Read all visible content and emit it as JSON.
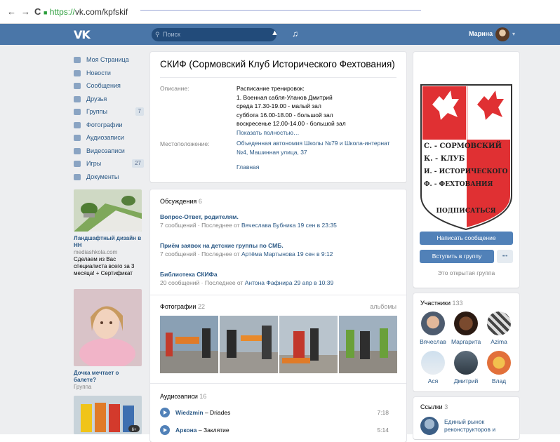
{
  "browser": {
    "back": "←",
    "forward": "→",
    "reload": "C",
    "lock": "🔒",
    "url_scheme": "https://",
    "url_rest": "vk.com/kpfskif"
  },
  "header": {
    "logo": "VK",
    "search_placeholder": "Поиск",
    "user_name": "Марина",
    "caret": "▾"
  },
  "menu": [
    {
      "label": "Моя Страница",
      "count": ""
    },
    {
      "label": "Новости",
      "count": ""
    },
    {
      "label": "Сообщения",
      "count": ""
    },
    {
      "label": "Друзья",
      "count": ""
    },
    {
      "label": "Группы",
      "count": "7"
    },
    {
      "label": "Фотографии",
      "count": ""
    },
    {
      "label": "Аудиозаписи",
      "count": ""
    },
    {
      "label": "Видеозаписи",
      "count": ""
    },
    {
      "label": "Игры",
      "count": "27"
    },
    {
      "label": "Документы",
      "count": ""
    }
  ],
  "ads": [
    {
      "title": "Ландшафтный дизайн в НН",
      "source": "mediashkola.com",
      "text": "Сделаем из Вас специалиста всего за 3 месяца! + Сертификат"
    },
    {
      "title": "Дочка мечтает о балете?",
      "source": "Группа"
    }
  ],
  "ad_badge": "6+",
  "group": {
    "title": "СКИФ (Сормовский Клуб Исторического Фехтования)",
    "desc_label": "Описание:",
    "desc_lines": [
      "Расписание тренировок:",
      "1. Военная сабля-Уланов Дмитрий",
      "среда 17.30-19.00 - малый зал",
      "суббота 16.00-18.00 - большой зал",
      "воскресенье 12.00-14.00 - большой зал"
    ],
    "show_more": "Показать полностью…",
    "loc_label": "Местоположение:",
    "loc_lines": [
      "Объеденная автономия Школы №79 и Школа-интернат",
      "№4, Машинная улица, 37"
    ],
    "main_link": "Главная"
  },
  "discussions": {
    "title": "Обсуждения",
    "count": "6",
    "topics": [
      {
        "name": "Вопрос-Ответ, родителям.",
        "meta": "7 сообщений · Последнее от ",
        "who": "Вячеслава Бубника 19 сен в 23:35"
      },
      {
        "name": "Приём заявок на детские группы по СМБ.",
        "meta": "7 сообщений · Последнее от ",
        "who": "Артёма Мартынова 19 сен в 9:12"
      },
      {
        "name": "Библиотека СКИФа",
        "meta": "20 сообщений · Последнее от ",
        "who": "Антона Фафнира 29 апр в 10:39"
      }
    ]
  },
  "photos": {
    "title": "Фотографии",
    "count": "22",
    "albums": "альбомы"
  },
  "audio": {
    "title": "Аудиозаписи",
    "count": "16",
    "tracks": [
      {
        "artist": "Wiedzmin",
        "sep": " – ",
        "song": "Driades",
        "duration": "7:18"
      },
      {
        "artist": "Аркона",
        "sep": " – ",
        "song": "Заклятие",
        "duration": "5:14"
      }
    ]
  },
  "emblem": {
    "lines": [
      "С. - СОРМОВСКИЙ",
      "К. - КЛУБ",
      "И. - ИСТОРИЧЕСКОГО",
      "Ф. - ФЕХТОВАНИЯ"
    ],
    "motto": "ПОДПИСАТЬСЯ"
  },
  "actions": {
    "message": "Написать сообщение",
    "join": "Вступить в группу",
    "more": "•••",
    "open_group": "Это открытая группа"
  },
  "members": {
    "title": "Участники",
    "count": "133",
    "people": [
      "Вячеслав",
      "Маргарита",
      "Azima",
      "Ася",
      "Дмитрий",
      "Влад"
    ]
  },
  "links": {
    "title": "Ссылки",
    "count": "3",
    "first_lines": [
      "Единый рынок",
      "реконструкторов и"
    ]
  },
  "colors": {
    "vk_blue": "#4a76a8",
    "link": "#2a5885",
    "button": "#5181b8",
    "emblem_red": "#e03033"
  }
}
